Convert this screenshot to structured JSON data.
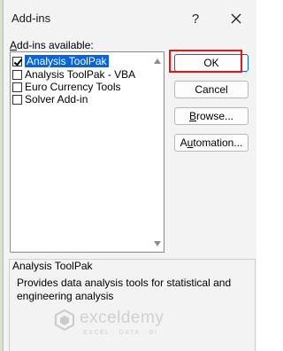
{
  "dialog": {
    "title": "Add-ins",
    "help_label": "?",
    "close_icon": "close-icon"
  },
  "addins_label": {
    "accel": "A",
    "rest": "dd-ins available:"
  },
  "addins": [
    {
      "label": "Analysis ToolPak",
      "checked": true,
      "selected": true
    },
    {
      "label": "Analysis ToolPak - VBA",
      "checked": false,
      "selected": false
    },
    {
      "label": "Euro Currency Tools",
      "checked": false,
      "selected": false
    },
    {
      "label": "Solver Add-in",
      "checked": false,
      "selected": false
    }
  ],
  "buttons": {
    "ok": "OK",
    "cancel": "Cancel",
    "browse": {
      "accel": "B",
      "rest": "rowse..."
    },
    "automation": {
      "accel": "u",
      "pre": "A",
      "rest": "tomation..."
    }
  },
  "description": {
    "title": "Analysis ToolPak",
    "text": "Provides data analysis tools for statistical and engineering analysis"
  },
  "watermark": {
    "name": "exceldemy",
    "tagline": "EXCEL · DATA · BI"
  },
  "colors": {
    "selection": "#0a64d6",
    "highlight": "#e8151b",
    "dialog_bg": "#f3f3f3"
  }
}
